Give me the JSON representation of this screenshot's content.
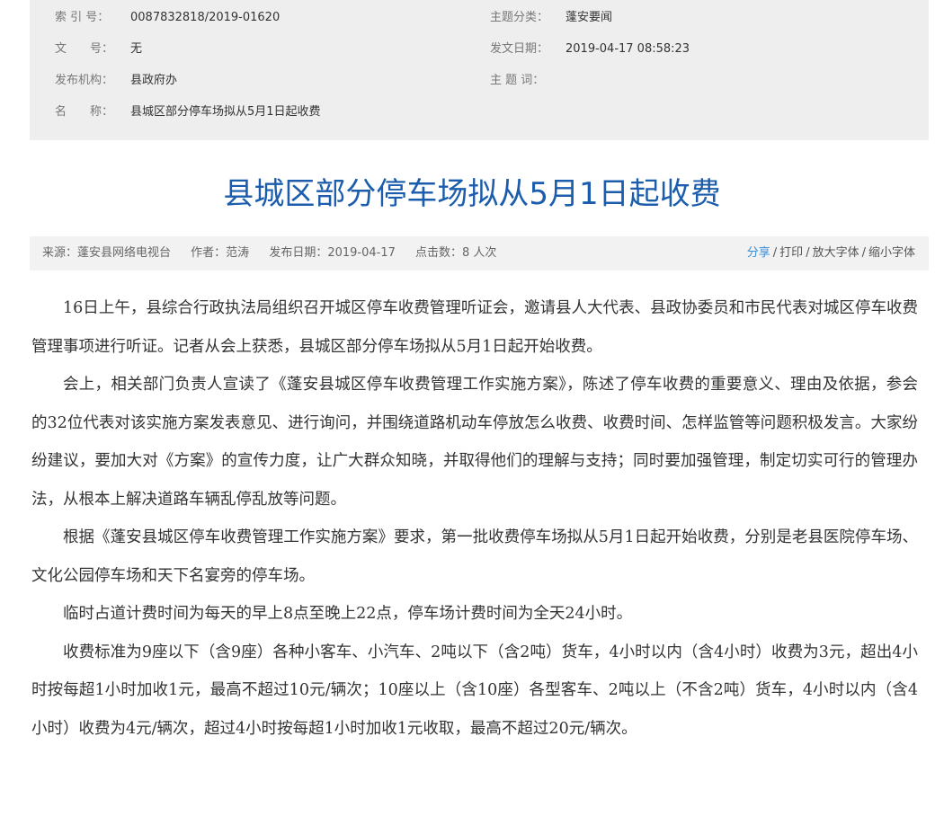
{
  "meta": {
    "index_label": "索 引 号：",
    "index_value": "0087832818/2019-01620",
    "category_label": "主题分类：",
    "category_value": "蓬安要闻",
    "docno_label": "文　　号：",
    "docno_value": "无",
    "date_label": "发文日期：",
    "date_value": "2019-04-17 08:58:23",
    "org_label": "发布机构：",
    "org_value": "县政府办",
    "keywords_label": "主 题 词：",
    "keywords_value": "",
    "name_label": "名　　称：",
    "name_value": "县城区部分停车场拟从5月1日起收费"
  },
  "article": {
    "title": "县城区部分停车场拟从5月1日起收费",
    "source": "来源：蓬安县网络电视台",
    "author": "作者：范涛",
    "publish_date": "发布日期：2019-04-17",
    "hits": "点击数：8 人次",
    "actions": {
      "share": "分享",
      "print": "打印",
      "enlarge": "放大字体",
      "shrink": "缩小字体",
      "separator": "/"
    },
    "paragraphs": [
      "16日上午，县综合行政执法局组织召开城区停车收费管理听证会，邀请县人大代表、县政协委员和市民代表对城区停车收费管理事项进行听证。记者从会上获悉，县城区部分停车场拟从5月1日起开始收费。",
      "会上，相关部门负责人宣读了《蓬安县城区停车收费管理工作实施方案》，陈述了停车收费的重要意义、理由及依据，参会的32位代表对该实施方案发表意见、进行询问，并围绕道路机动车停放怎么收费、收费时间、怎样监管等问题积极发言。大家纷纷建议，要加大对《方案》的宣传力度，让广大群众知晓，并取得他们的理解与支持；同时要加强管理，制定切实可行的管理办法，从根本上解决道路车辆乱停乱放等问题。",
      "根据《蓬安县城区停车收费管理工作实施方案》要求，第一批收费停车场拟从5月1日起开始收费，分别是老县医院停车场、文化公园停车场和天下名宴旁的停车场。",
      "临时占道计费时间为每天的早上8点至晚上22点，停车场计费时间为全天24小时。",
      "收费标准为9座以下（含9座）各种小客车、小汽车、2吨以下（含2吨）货车，4小时以内（含4小时）收费为3元，超出4小时按每超1小时加收1元，最高不超过10元/辆次；10座以上（含10座）各型客车、2吨以上（不含2吨）货车，4小时以内（含4小时）收费为4元/辆次，超过4小时按每超1小时加收1元收取，最高不超过20元/辆次。"
    ]
  },
  "colors": {
    "title": "#1b5dac",
    "share_link": "#3a8ed6",
    "meta_bg": "#eeeeee",
    "info_bg": "#f2f2f2"
  }
}
